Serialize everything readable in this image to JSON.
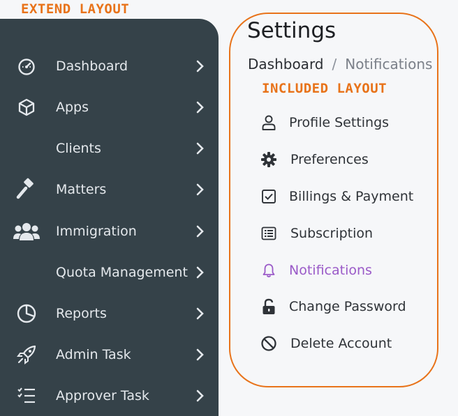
{
  "annotations": {
    "extend": "EXTEND LAYOUT",
    "included": "INCLUDED LAYOUT"
  },
  "sidebar": {
    "items": [
      {
        "label": "Dashboard",
        "icon": "speedometer-icon"
      },
      {
        "label": "Apps",
        "icon": "cube-icon"
      },
      {
        "label": "Clients",
        "icon": ""
      },
      {
        "label": "Matters",
        "icon": "gavel-icon"
      },
      {
        "label": "Immigration",
        "icon": "users-group-icon"
      },
      {
        "label": "Quota Management",
        "icon": ""
      },
      {
        "label": "Reports",
        "icon": "pie-chart-icon"
      },
      {
        "label": "Admin Task",
        "icon": "rocket-icon"
      },
      {
        "label": "Approver Task",
        "icon": "checklist-icon"
      }
    ]
  },
  "settings": {
    "title": "Settings",
    "breadcrumb": {
      "root": "Dashboard",
      "separator": "/",
      "current": "Notifications"
    },
    "menu": [
      {
        "label": "Profile Settings",
        "icon": "user-icon"
      },
      {
        "label": "Preferences",
        "icon": "gear-icon"
      },
      {
        "label": "Billings & Payment",
        "icon": "checkbox-icon"
      },
      {
        "label": "Subscription",
        "icon": "list-icon"
      },
      {
        "label": "Notifications",
        "icon": "bell-icon",
        "active": true
      },
      {
        "label": "Change Password",
        "icon": "unlock-icon"
      },
      {
        "label": "Delete Account",
        "icon": "ban-icon"
      }
    ]
  },
  "colors": {
    "sidebar_bg": "#354249",
    "accent_active": "#9a5ac8",
    "annotation": "#e8731a"
  }
}
